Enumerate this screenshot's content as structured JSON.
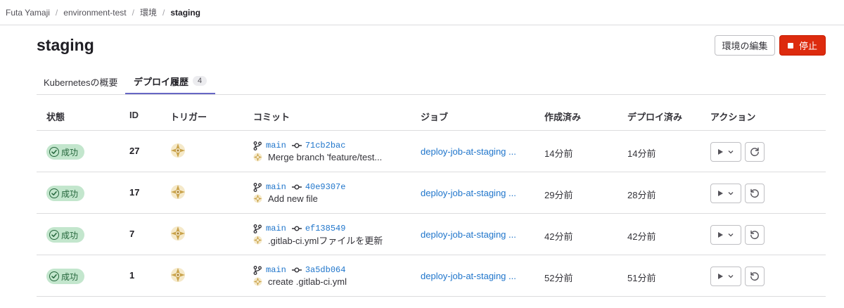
{
  "breadcrumb": {
    "items": [
      "Futa Yamaji",
      "environment-test",
      "環境"
    ],
    "current": "staging",
    "separator": "/"
  },
  "header": {
    "title": "staging",
    "edit_label": "環境の編集",
    "stop_label": "停止"
  },
  "tabs": [
    {
      "label": "Kubernetesの概要"
    },
    {
      "label": "デプロイ履歴",
      "count": "4"
    }
  ],
  "table": {
    "headers": [
      "状態",
      "ID",
      "トリガー",
      "コミット",
      "ジョブ",
      "作成済み",
      "デプロイ済み",
      "アクション"
    ],
    "rows": [
      {
        "status": "成功",
        "id": "27",
        "branch": "main",
        "sha": "71cb2bac",
        "message": "Merge branch 'feature/test...",
        "job": "deploy-job-at-staging ...",
        "created": "14分前",
        "deployed": "14分前",
        "redo": "retry"
      },
      {
        "status": "成功",
        "id": "17",
        "branch": "main",
        "sha": "40e9307e",
        "message": "Add new file",
        "job": "deploy-job-at-staging ...",
        "created": "29分前",
        "deployed": "28分前",
        "redo": "rollback"
      },
      {
        "status": "成功",
        "id": "7",
        "branch": "main",
        "sha": "ef138549",
        "message": ".gitlab-ci.ymlファイルを更新",
        "job": "deploy-job-at-staging ...",
        "created": "42分前",
        "deployed": "42分前",
        "redo": "rollback"
      },
      {
        "status": "成功",
        "id": "1",
        "branch": "main",
        "sha": "3a5db064",
        "message": "create .gitlab-ci.yml",
        "job": "deploy-job-at-staging ...",
        "created": "52分前",
        "deployed": "51分前",
        "redo": "rollback"
      }
    ]
  },
  "colors": {
    "accent_tab": "#6666c4",
    "stop_button": "#dd2b0e",
    "link": "#1f75cb",
    "success_bg": "#c3e6cd",
    "success_fg": "#24663b"
  },
  "icons": {
    "status": "check-circle-icon",
    "branch": "branch-icon",
    "commit": "commit-icon",
    "play": "play-icon",
    "chevron": "chevron-down-icon",
    "retry": "retry-icon",
    "rollback": "rollback-icon",
    "stop": "stop-icon"
  }
}
